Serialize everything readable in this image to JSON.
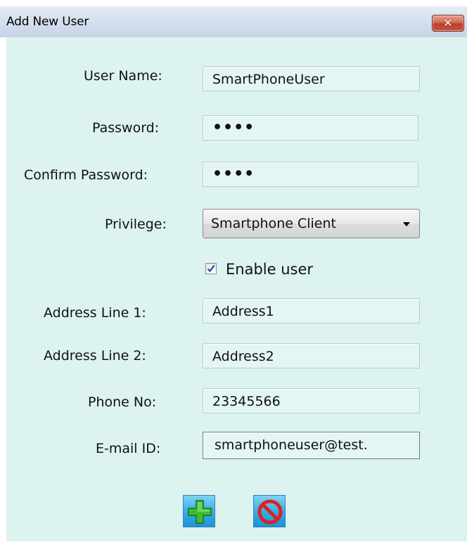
{
  "window": {
    "title": "Add New User",
    "close_icon": "close-icon"
  },
  "form": {
    "username": {
      "label": "User Name:",
      "value": "SmartPhoneUser"
    },
    "password": {
      "label": "Password:",
      "value": "••••"
    },
    "confirm_password": {
      "label": "Confirm Password:",
      "value": "••••"
    },
    "privilege": {
      "label": "Privilege:",
      "selected": "Smartphone Client"
    },
    "enable_user": {
      "label": "Enable user",
      "checked": true
    },
    "address1": {
      "label": "Address Line 1:",
      "value": "Address1"
    },
    "address2": {
      "label": "Address Line 2:",
      "value": "Address2"
    },
    "phone": {
      "label": "Phone No:",
      "value": "23345566"
    },
    "email": {
      "label": "E-mail ID:",
      "value": "smartphoneuser@test."
    }
  },
  "actions": {
    "add_icon": "plus-icon",
    "cancel_icon": "no-entry-icon"
  },
  "colors": {
    "form_background": "#dcf3f0",
    "field_background": "#e3f6f3",
    "button_blue": "#34aee8",
    "plus_green": "#3fbb2f",
    "cancel_red": "#e02020"
  }
}
